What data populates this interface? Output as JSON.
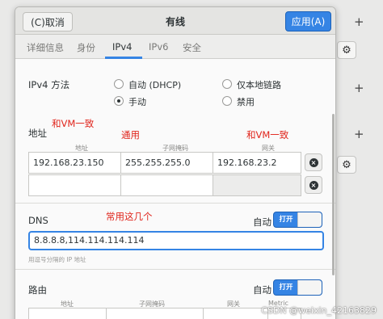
{
  "header": {
    "cancel_label": "(C)取消",
    "title": "有线",
    "apply_label": "应用(A)"
  },
  "tabs": [
    {
      "label": "详细信息"
    },
    {
      "label": "身份"
    },
    {
      "label": "IPv4"
    },
    {
      "label": "IPv6"
    },
    {
      "label": "安全"
    }
  ],
  "ipv4": {
    "method_label": "IPv4 方法",
    "methods": [
      {
        "label": "自动 (DHCP)",
        "checked": false
      },
      {
        "label": "仅本地链路",
        "checked": false
      },
      {
        "label": "手动",
        "checked": true
      },
      {
        "label": "禁用",
        "checked": false
      }
    ]
  },
  "address": {
    "section_label": "地址",
    "columns": [
      "地址",
      "子网掩码",
      "网关"
    ],
    "rows": [
      [
        "192.168.23.150",
        "255.255.255.0",
        "192.168.23.2"
      ],
      [
        "",
        "",
        ""
      ]
    ]
  },
  "annotations": {
    "note_vm_1": "和VM一致",
    "note_common": "通用",
    "note_vm_2": "和VM一致",
    "note_dns": "常用这几个"
  },
  "dns": {
    "label": "DNS",
    "auto_label": "自动",
    "toggle_label": "打开",
    "value": "8.8.8.8,114.114.114.114",
    "hint": "用逗号分隔的 IP 地址"
  },
  "routes": {
    "label": "路由",
    "auto_label": "自动",
    "toggle_label": "打开",
    "columns": [
      "地址",
      "子网掩码",
      "网关",
      "Metric"
    ]
  },
  "watermark": "CSDN @weixin_42163829",
  "colors": {
    "accent": "#3584e4",
    "annotation": "#e0241b"
  },
  "icons": [
    "plus-icon",
    "gear-icon",
    "delete-icon"
  ]
}
